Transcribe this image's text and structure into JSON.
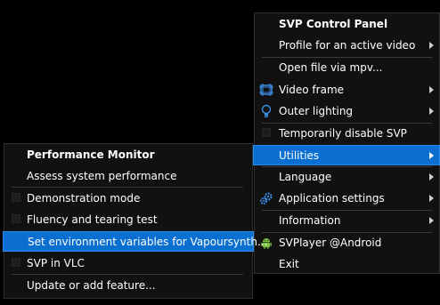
{
  "main_menu": {
    "title": "SVP Control Panel",
    "items": [
      {
        "label": "Profile for an active video"
      },
      {
        "label": "Open file via mpv..."
      },
      {
        "label": "Video frame"
      },
      {
        "label": "Outer lighting"
      },
      {
        "label": "Temporarily disable SVP"
      },
      {
        "label": "Utilities"
      },
      {
        "label": "Language"
      },
      {
        "label": "Application settings"
      },
      {
        "label": "Information"
      },
      {
        "label": "SVPlayer @Android"
      },
      {
        "label": "Exit"
      }
    ]
  },
  "utilities_submenu": {
    "title": "Performance Monitor",
    "items": [
      {
        "label": "Assess system performance"
      },
      {
        "label": "Demonstration mode"
      },
      {
        "label": "Fluency and tearing test"
      },
      {
        "label": "Set environment variables for Vapoursynth..."
      },
      {
        "label": "SVP in VLC"
      },
      {
        "label": "Update or add feature..."
      }
    ]
  },
  "colors": {
    "highlight": "#0a6fd0",
    "menu_background": "#111111",
    "android_green": "#7cc242"
  }
}
